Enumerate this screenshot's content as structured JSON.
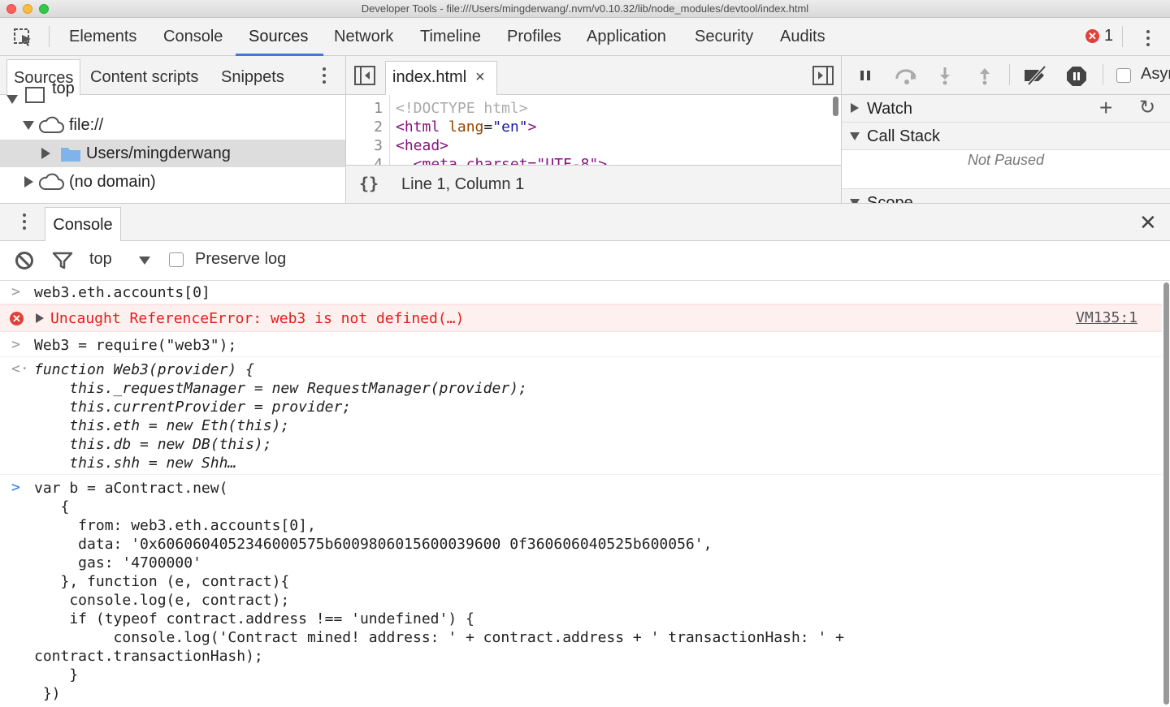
{
  "window": {
    "title": "Developer Tools - file:///Users/mingderwang/.nvm/v0.10.32/lib/node_modules/devtool/index.html"
  },
  "main_tabs": [
    {
      "label": "Elements"
    },
    {
      "label": "Console"
    },
    {
      "label": "Sources",
      "active": true
    },
    {
      "label": "Network"
    },
    {
      "label": "Timeline"
    },
    {
      "label": "Profiles"
    },
    {
      "label": "Application"
    },
    {
      "label": "Security"
    },
    {
      "label": "Audits"
    }
  ],
  "error_badge": {
    "count": "1",
    "icon": "error-icon",
    "color": "#e0413b"
  },
  "navigator": {
    "tabs": [
      {
        "label": "Sources",
        "active": true
      },
      {
        "label": "Content scripts"
      },
      {
        "label": "Snippets"
      }
    ],
    "tree": [
      {
        "label": "top",
        "icon": "frame-icon",
        "expanded": true
      },
      {
        "label": "file://",
        "icon": "cloud-icon",
        "expanded": true
      },
      {
        "label": "Users/mingderwang",
        "icon": "folder-icon",
        "expanded": false,
        "selected": true
      },
      {
        "label": "(no domain)",
        "icon": "cloud-icon",
        "expanded": false
      }
    ]
  },
  "editor": {
    "open_file": "index.html",
    "close_glyph": "×",
    "lines": [
      {
        "num": "1",
        "text": "<!DOCTYPE html>"
      },
      {
        "num": "2",
        "tag_open": "<html ",
        "attr": "lang",
        "eq": "=",
        "val": "\"en\"",
        "tag_close": ">"
      },
      {
        "num": "3",
        "text": "<head>"
      },
      {
        "num": "4",
        "text": "  <meta charset=\"UTF-8\">"
      }
    ],
    "pretty_print": "{}",
    "status": "Line 1, Column 1"
  },
  "debugger": {
    "async_label": "Async",
    "sections": [
      {
        "label": "Watch",
        "expanded": false
      },
      {
        "label": "Call Stack",
        "expanded": true
      },
      {
        "label": "Scope",
        "expanded": true
      }
    ],
    "call_stack_status": "Not Paused"
  },
  "drawer": {
    "tab_label": "Console",
    "close_glyph": "✕"
  },
  "console_toolbar": {
    "context": "top",
    "preserve_log_label": "Preserve log",
    "preserve_log_checked": false
  },
  "console": {
    "entries": [
      {
        "type": "input",
        "text": "web3.eth.accounts[0]"
      },
      {
        "type": "error",
        "text": "Uncaught ReferenceError: web3 is not defined(…)",
        "source": "VM135:1"
      },
      {
        "type": "input",
        "text": "Web3 = require(\"web3\");"
      },
      {
        "type": "output",
        "lines": [
          "function Web3(provider) {",
          "    this._requestManager = new RequestManager(provider);",
          "    this.currentProvider = provider;",
          "    this.eth = new Eth(this);",
          "    this.db = new DB(this);",
          "    this.shh = new Shh…"
        ]
      },
      {
        "type": "prompt",
        "lines": [
          "var b = aContract.new(",
          "   {",
          "     from: web3.eth.accounts[0],",
          "     data: '0x6060604052346000575b6009806015600039600 0f360606040525b600056',",
          "     gas: '4700000'",
          "   }, function (e, contract){",
          "    console.log(e, contract);",
          "    if (typeof contract.address !== 'undefined') {",
          "         console.log('Contract mined! address: ' + contract.address + ' transactionHash: ' +",
          "contract.transactionHash);",
          "    }",
          " })"
        ]
      }
    ]
  }
}
